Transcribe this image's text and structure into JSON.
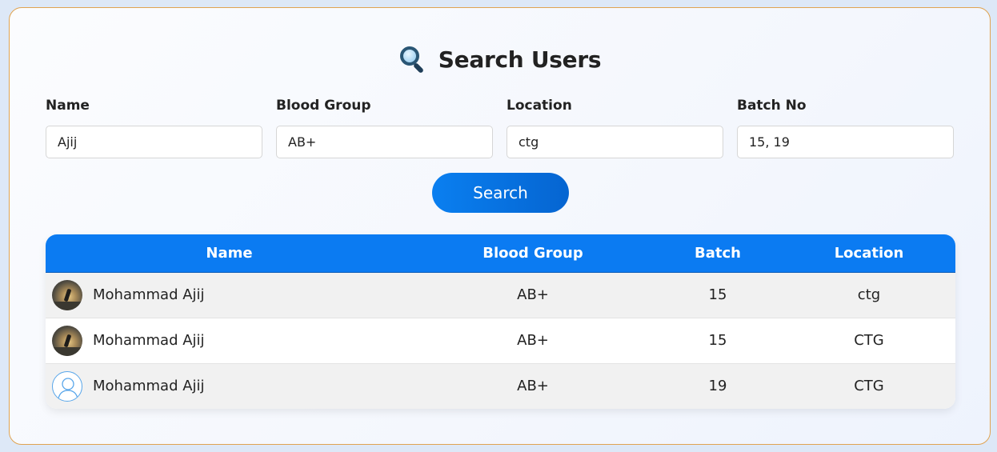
{
  "page": {
    "title": "Search Users",
    "title_icon": "magnifying-glass-icon"
  },
  "search_form": {
    "fields": [
      {
        "label": "Name",
        "value": "Ajij"
      },
      {
        "label": "Blood Group",
        "value": "AB+"
      },
      {
        "label": "Location",
        "value": "ctg"
      },
      {
        "label": "Batch No",
        "value": "15, 19"
      }
    ],
    "button_label": "Search"
  },
  "results_table": {
    "columns": [
      "Name",
      "Blood Group",
      "Batch",
      "Location"
    ],
    "rows": [
      {
        "name": "Mohammad Ajij",
        "blood_group": "AB+",
        "batch": "15",
        "location": "ctg",
        "avatar": "photo"
      },
      {
        "name": "Mohammad Ajij",
        "blood_group": "AB+",
        "batch": "15",
        "location": "CTG",
        "avatar": "photo"
      },
      {
        "name": "Mohammad Ajij",
        "blood_group": "AB+",
        "batch": "19",
        "location": "CTG",
        "avatar": "default-user-icon"
      }
    ]
  },
  "colors": {
    "accent": "#0b7bf2",
    "card_border": "#e0a350"
  }
}
